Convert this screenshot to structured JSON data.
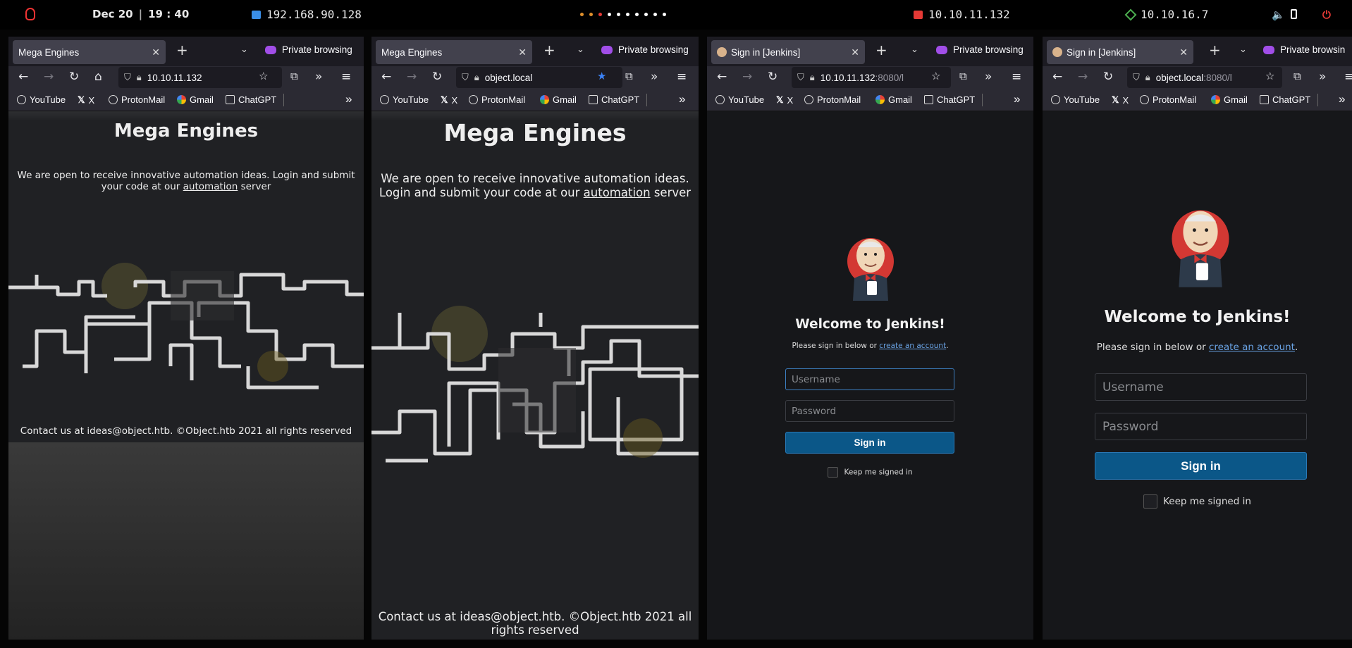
{
  "sysbar": {
    "date": "Dec 20",
    "time": "19 : 40",
    "vm_ip": "192.168.90.128",
    "target_ip": "10.10.11.132",
    "vpn_ip": "10.10.16.7"
  },
  "panes": [
    {
      "tab_title": "Mega Engines",
      "private_label": "Private browsing",
      "url": "10.10.11.132",
      "url_gray": "",
      "page": {
        "title": "Mega Engines",
        "para_before": "We are open to receive innovative automation ideas. Login and submit your code at our ",
        "link": "automation",
        "para_after": " server",
        "footer": "Contact us at ideas@object.htb. ©Object.htb 2021 all rights reserved"
      }
    },
    {
      "tab_title": "Mega Engines",
      "private_label": "Private browsing",
      "url": "object.local",
      "url_gray": "",
      "page": {
        "title": "Mega Engines",
        "para_before": "We are open to receive innovative automation ideas. Login and submit your code at our ",
        "link": "automation",
        "para_after": " server",
        "footer": "Contact us at ideas@object.htb. ©Object.htb 2021 all rights reserved"
      }
    },
    {
      "tab_title": "Sign in [Jenkins]",
      "private_label": "Private browsing",
      "url": "10.10.11.132",
      "url_gray": ":8080/l",
      "page": {
        "welcome": "Welcome to Jenkins!",
        "signin_text": "Please sign in below or ",
        "create_link": "create an account",
        "period": ".",
        "username_placeholder": "Username",
        "password_placeholder": "Password",
        "signin_button": "Sign in",
        "keep_label": "Keep me signed in"
      }
    },
    {
      "tab_title": "Sign in [Jenkins]",
      "private_label": "Private browsin",
      "url": "object.local",
      "url_gray": ":8080/l",
      "page": {
        "welcome": "Welcome to Jenkins!",
        "signin_text": "Please sign in below or ",
        "create_link": "create an account",
        "period": ".",
        "username_placeholder": "Username",
        "password_placeholder": "Password",
        "signin_button": "Sign in",
        "keep_label": "Keep me signed in"
      }
    }
  ],
  "bookmarks": [
    "YouTube",
    "X",
    "ProtonMail",
    "Gmail",
    "ChatGPT"
  ],
  "colors": {
    "private_accent": "#a14ee8",
    "jenkins_button": "#0b5788",
    "link_blue": "#6aa4e6",
    "bookmark_star": "#3b82f6"
  }
}
